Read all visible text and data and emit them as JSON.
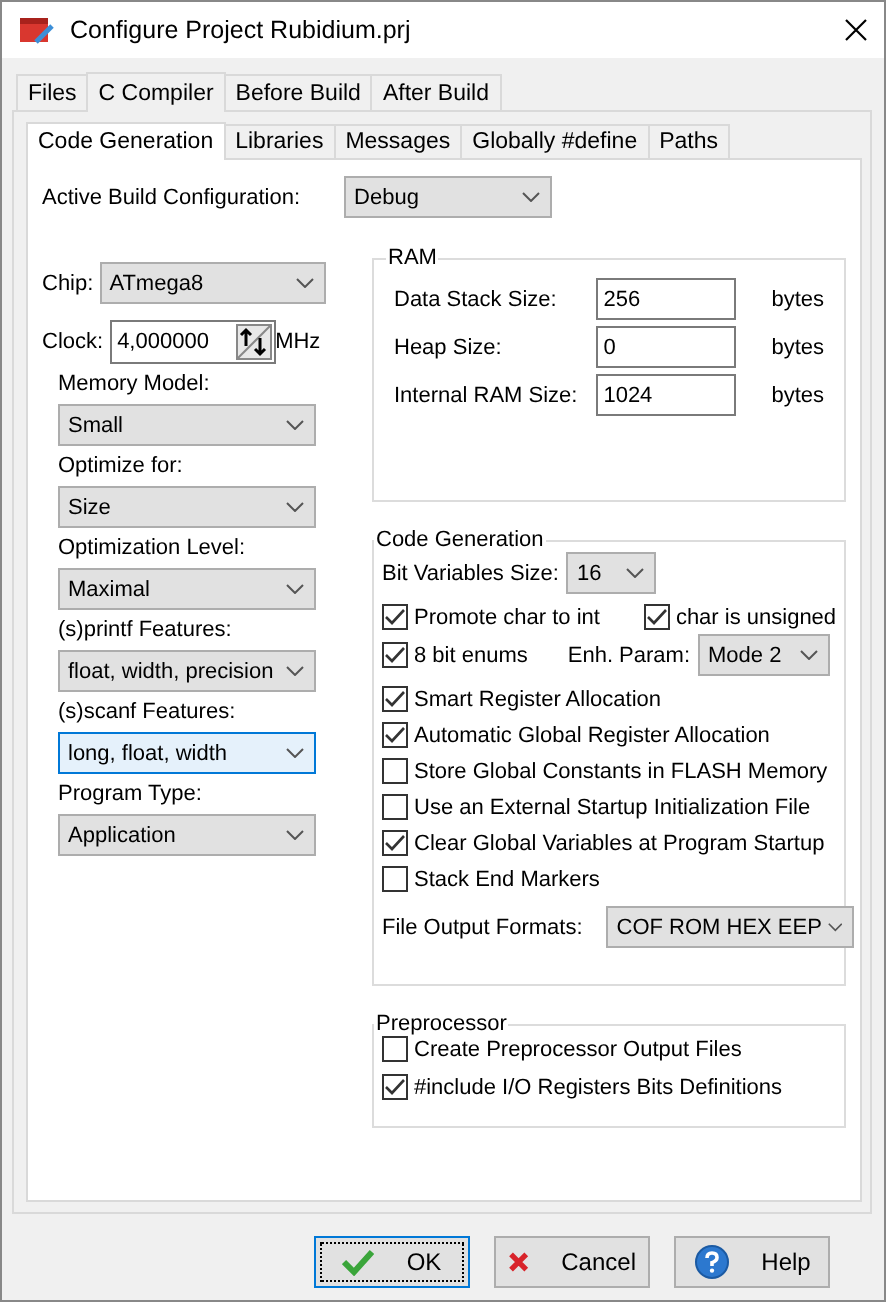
{
  "window": {
    "title": "Configure Project Rubidium.prj"
  },
  "outer_tabs": [
    {
      "label": "Files",
      "selected": false
    },
    {
      "label": "C Compiler",
      "selected": true
    },
    {
      "label": "Before Build",
      "selected": false
    },
    {
      "label": "After Build",
      "selected": false
    }
  ],
  "inner_tabs": [
    {
      "label": "Code Generation",
      "selected": true
    },
    {
      "label": "Libraries",
      "selected": false
    },
    {
      "label": "Messages",
      "selected": false
    },
    {
      "label": "Globally #define",
      "selected": false
    },
    {
      "label": "Paths",
      "selected": false
    }
  ],
  "active_build_configuration": {
    "label": "Active Build Configuration:",
    "value": "Debug"
  },
  "chip": {
    "label": "Chip:",
    "value": "ATmega8"
  },
  "clock": {
    "label": "Clock:",
    "value": "4,000000",
    "unit": "MHz"
  },
  "left_fields": [
    {
      "label": "Memory Model:",
      "value": "Small",
      "focused": false
    },
    {
      "label": "Optimize for:",
      "value": "Size",
      "focused": false
    },
    {
      "label": "Optimization Level:",
      "value": "Maximal",
      "focused": false
    },
    {
      "label": "(s)printf Features:",
      "value": "float, width, precision",
      "focused": false
    },
    {
      "label": "(s)scanf Features:",
      "value": "long, float, width",
      "focused": true
    },
    {
      "label": "Program Type:",
      "value": "Application",
      "focused": false
    }
  ],
  "ram": {
    "title": "RAM",
    "rows": [
      {
        "label": "Data Stack Size:",
        "value": "256",
        "unit": "bytes"
      },
      {
        "label": "Heap Size:",
        "value": "0",
        "unit": "bytes"
      },
      {
        "label": "Internal RAM Size:",
        "value": "1024",
        "unit": "bytes"
      }
    ]
  },
  "code_generation": {
    "title": "Code Generation",
    "bit_variables_size": {
      "label": "Bit Variables Size:",
      "value": "16"
    },
    "promote_char": {
      "label": "Promote char to int",
      "checked": true
    },
    "char_unsigned": {
      "label": "char is unsigned",
      "checked": true
    },
    "enums_8bit": {
      "label": "8 bit enums",
      "checked": true
    },
    "enh_param": {
      "label": "Enh. Param:",
      "value": "Mode 2"
    },
    "options": [
      {
        "label": "Smart Register Allocation",
        "checked": true
      },
      {
        "label": "Automatic Global Register Allocation",
        "checked": true
      },
      {
        "label": "Store Global Constants in FLASH Memory",
        "checked": false
      },
      {
        "label": "Use an External Startup Initialization File",
        "checked": false
      },
      {
        "label": "Clear Global Variables at Program Startup",
        "checked": true
      },
      {
        "label": "Stack End Markers",
        "checked": false
      }
    ],
    "file_output_formats": {
      "label": "File Output Formats:",
      "value": "COF ROM HEX EEP"
    }
  },
  "preprocessor": {
    "title": "Preprocessor",
    "options": [
      {
        "label": "Create Preprocessor Output Files",
        "checked": false
      },
      {
        "label": "#include I/O Registers Bits Definitions",
        "checked": true
      }
    ]
  },
  "buttons": [
    {
      "kind": "ok",
      "label": "OK",
      "focused": true
    },
    {
      "kind": "cancel",
      "label": "Cancel",
      "focused": false
    },
    {
      "kind": "help",
      "label": "Help",
      "focused": false
    }
  ]
}
